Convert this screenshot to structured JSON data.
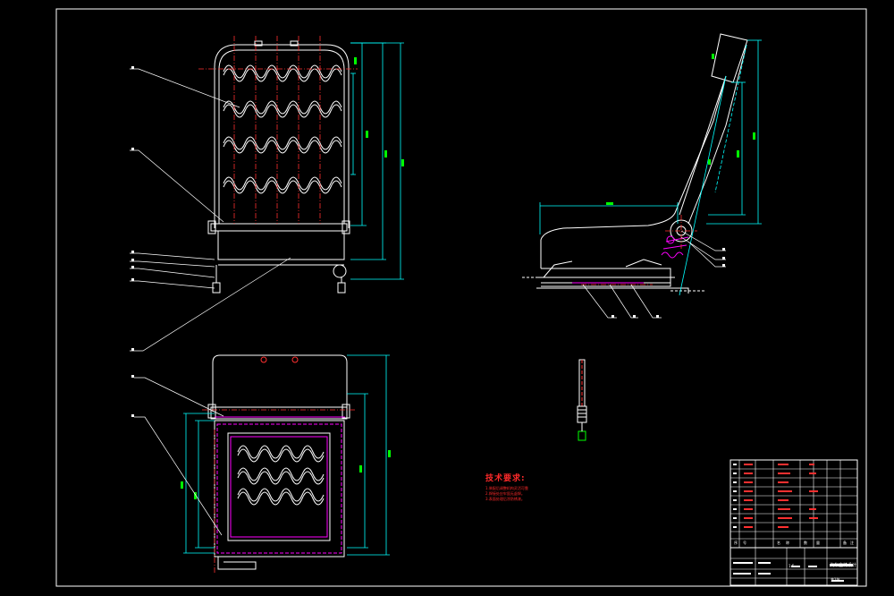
{
  "drawing": {
    "background": "#000000",
    "line_colors": {
      "frame": "#ffffff",
      "spring": "#ffffff",
      "dimension": "#00ffff",
      "centerline": "#ff3030",
      "highlight": "#ff00ff",
      "leader": "#ffffff",
      "text": "#00ff00"
    }
  },
  "views": {
    "front_view": {
      "name": "seat-back-front-view"
    },
    "top_view": {
      "name": "seat-cushion-top-view"
    },
    "side_view": {
      "name": "seat-side-view"
    },
    "detail_view": {
      "name": "adjuster-detail-view"
    }
  },
  "technical_requirements": {
    "title": "技术要求:",
    "lines": [
      "1.装配后调整机构灵活可靠",
      "2.焊接处应牢固无虚焊。",
      "3.表面处理后涂防锈漆。"
    ]
  },
  "title_block": {
    "drawing_title": "汽车座椅设计",
    "scale_label": "1:5",
    "sheet_label": "共1张",
    "rows": 14,
    "header_labels": [
      "序",
      "号",
      "名",
      "称",
      "数",
      "量",
      "备",
      "注"
    ]
  }
}
